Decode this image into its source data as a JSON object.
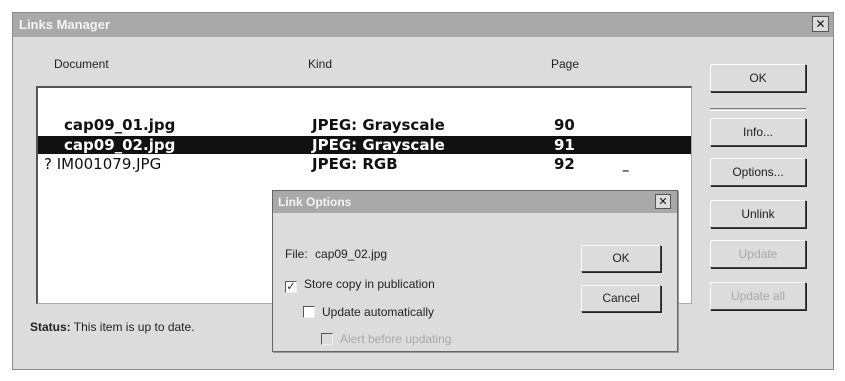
{
  "window": {
    "title": "Links Manager",
    "close_glyph": "✕"
  },
  "columns": {
    "document": "Document",
    "kind": "Kind",
    "page": "Page"
  },
  "rows": [
    {
      "document": "cap09_01.jpg",
      "kind": "JPEG: Grayscale",
      "page": "90",
      "flag": "",
      "selected": false
    },
    {
      "document": "cap09_02.jpg",
      "kind": "JPEG: Grayscale",
      "page": "91",
      "flag": "",
      "selected": true
    },
    {
      "document": "? IM001079.JPG",
      "kind": "JPEG: RGB",
      "page": "92",
      "flag": "–",
      "selected": false
    }
  ],
  "status": {
    "label": "Status:",
    "text": "This item is up to date."
  },
  "buttons": {
    "ok": "OK",
    "info": "Info...",
    "options": "Options...",
    "unlink": "Unlink",
    "update": "Update",
    "update_all": "Update all"
  },
  "link_options": {
    "title": "Link Options",
    "close_glyph": "✕",
    "file_label": "File:",
    "file_value": "cap09_02.jpg",
    "store_copy": {
      "label": "Store copy in publication",
      "checked": true,
      "check_glyph": "✓"
    },
    "update_auto": {
      "label": "Update automatically",
      "checked": false
    },
    "alert_before": {
      "label": "Alert before updating",
      "checked": false,
      "enabled": false
    },
    "ok": "OK",
    "cancel": "Cancel"
  }
}
